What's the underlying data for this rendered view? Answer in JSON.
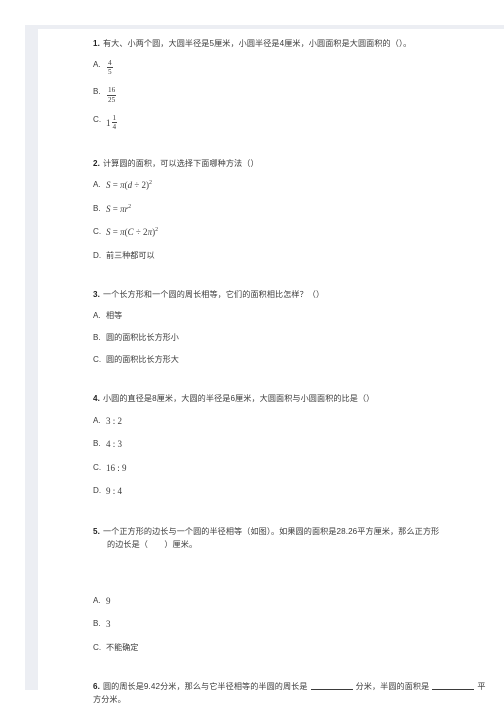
{
  "document": {
    "type": "math-worksheet",
    "subject_hint": "圆的面积与周长",
    "background_color": "#ffffff",
    "page_edge_color": "#eceef3",
    "text_color": "#3b3b3b"
  },
  "questions": [
    {
      "number": "1.",
      "stem": "有大、小两个圆，大圆半径是5厘米，小圆半径是4厘米，小圆面积是大圆面积的（）。",
      "choices": [
        {
          "letter": "A.",
          "kind": "fraction",
          "numerator": "4",
          "denominator": "5",
          "integer": ""
        },
        {
          "letter": "B.",
          "kind": "fraction",
          "numerator": "16",
          "denominator": "25",
          "integer": ""
        },
        {
          "letter": "C.",
          "kind": "mixed",
          "numerator": "1",
          "denominator": "4",
          "integer": "1"
        }
      ]
    },
    {
      "number": "2.",
      "stem": "计算圆的面积，可以选择下面哪种方法（）",
      "choices": [
        {
          "letter": "A.",
          "kind": "formula",
          "formula_id": "f-d-half-sq",
          "text": "S = π(d ÷ 2)²"
        },
        {
          "letter": "B.",
          "kind": "formula",
          "formula_id": "f-pi-r-sq",
          "text": "S = πr²"
        },
        {
          "letter": "C.",
          "kind": "formula",
          "formula_id": "f-c-2pi-sq",
          "text": "S = π(C ÷ 2π)²"
        },
        {
          "letter": "D.",
          "kind": "text",
          "text": "前三种都可以"
        }
      ]
    },
    {
      "number": "3.",
      "stem": "一个长方形和一个圆的周长相等，它们的面积相比怎样？（）",
      "choices": [
        {
          "letter": "A.",
          "kind": "text",
          "text": "相等"
        },
        {
          "letter": "B.",
          "kind": "text",
          "text": "圆的面积比长方形小"
        },
        {
          "letter": "C.",
          "kind": "text",
          "text": "圆的面积比长方形大"
        }
      ]
    },
    {
      "number": "4.",
      "stem": "小圆的直径是8厘米，大圆的半径是6厘米，大圆面积与小圆面积的比是（）",
      "choices": [
        {
          "letter": "A.",
          "kind": "ratio",
          "text": "3 : 2"
        },
        {
          "letter": "B.",
          "kind": "ratio",
          "text": "4 : 3"
        },
        {
          "letter": "C.",
          "kind": "ratio",
          "text": "16 : 9"
        },
        {
          "letter": "D.",
          "kind": "ratio",
          "text": "9 : 4"
        }
      ]
    },
    {
      "number": "5.",
      "stem_line1": "一个正方形的边长与一个圆的半径相等（如图）。如果圆的面积是28.26平方厘米，那么正方形",
      "stem_line2": "的边长是（　　）厘米。",
      "has_figure_gap": true,
      "choices": [
        {
          "letter": "A.",
          "kind": "number",
          "text": "9"
        },
        {
          "letter": "B.",
          "kind": "number",
          "text": "3"
        },
        {
          "letter": "C.",
          "kind": "text",
          "text": "不能确定"
        }
      ]
    },
    {
      "number": "6.",
      "kind": "fill-in-blank",
      "segments": {
        "s1": "圆的周长是9.42分米，那么与它半径相等的半圆的周长是",
        "s2": "分米，半圆的面积是",
        "s3": "平方分米。"
      }
    }
  ]
}
